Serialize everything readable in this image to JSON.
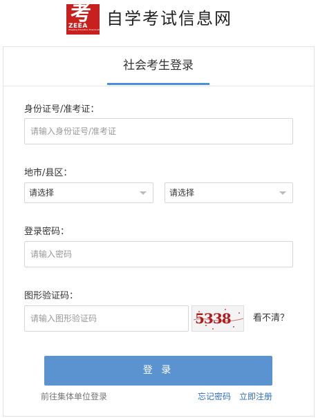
{
  "header": {
    "logo_glyph": "考",
    "logo_abbr": "ZEEA",
    "logo_sub": "Zhejiang Education Examinations Authority",
    "site_name": "自学考试信息网"
  },
  "tab": {
    "title": "社会考生登录"
  },
  "form": {
    "id_label": "身份证号/准考证：",
    "id_placeholder": "请输入身份证号/准考证",
    "region_label": "地市/县区：",
    "city_select": "请选择",
    "county_select": "请选择",
    "password_label": "登录密码：",
    "password_placeholder": "请输入密码",
    "captcha_label": "图形验证码：",
    "captcha_placeholder": "请输入图形验证码",
    "captcha_code": "5338",
    "refresh_text": "看不清？"
  },
  "actions": {
    "login_button": "登 录",
    "unit_login_link": "前往集体单位登录",
    "forgot_password_link": "忘记密码",
    "register_link": "立即注册"
  },
  "colors": {
    "accent": "#5b93d1",
    "link": "#2f6fc0",
    "logo_red": "#c8201e"
  }
}
